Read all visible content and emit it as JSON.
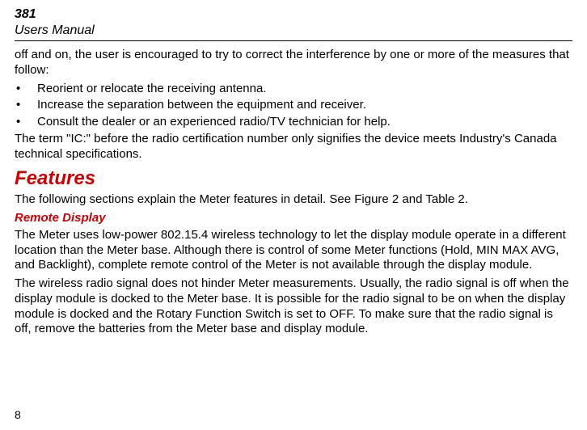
{
  "header": {
    "model": "381",
    "sub": "Users Manual"
  },
  "intro": {
    "lead": "off and on, the user is encouraged to try to correct the interference by one or more of the measures that follow:",
    "bullets": [
      "Reorient or relocate the receiving antenna.",
      "Increase the separation between the equipment and receiver.",
      "Consult the dealer or an experienced radio/TV technician for help."
    ],
    "ic_note": "The term \"IC:\" before the radio certification number only signifies the device meets Industry's Canada technical specifications."
  },
  "features": {
    "heading": "Features",
    "intro": "The following sections explain the Meter features in detail. See Figure 2 and Table 2.",
    "remote": {
      "heading": "Remote Display",
      "p1": "The Meter uses low-power 802.15.4 wireless technology to let the display module operate in a different location than the Meter base. Although there is control of some Meter functions (Hold, MIN MAX AVG, and Backlight), complete remote control of the Meter is not available through the display module.",
      "p2": "The wireless radio signal does not hinder Meter measurements. Usually, the radio signal is off when the display module is docked to the Meter base. It is possible for the radio signal to be on when the display module is docked and the Rotary Function Switch is set to OFF. To make sure that the radio signal is off, remove the batteries from the Meter base and display module."
    }
  },
  "page_number": "8"
}
